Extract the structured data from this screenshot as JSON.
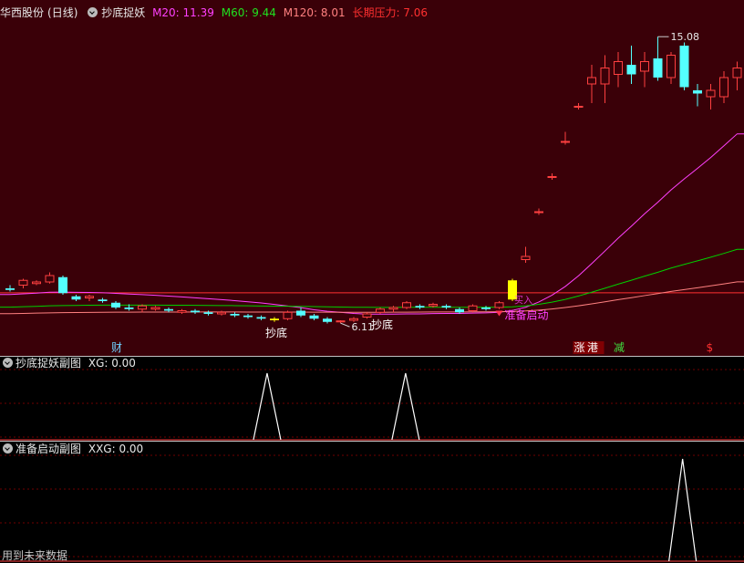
{
  "header": {
    "stock": "华西股份",
    "period": "(日线)",
    "indicator": "抄底捉妖",
    "ma20": "M20: 11.39",
    "ma60": "M60: 9.44",
    "ma120": "M120: 8.01",
    "pressure": "长期压力: 7.06"
  },
  "main_chart": {
    "high_label": "15.08",
    "low_label": "6.11",
    "signal_labels": [
      "抄底",
      "抄底"
    ],
    "start_label": "准备启动",
    "buy_label": "买入",
    "event_marks": [
      "财",
      "涨",
      "港",
      "减",
      "$"
    ]
  },
  "panel1": {
    "title": "抄底捉妖副图",
    "value_label": "XG: 0.00"
  },
  "panel2": {
    "title": "准备启动副图",
    "value_label": "XXG: 0.00"
  },
  "footer": {
    "text": "用到未来数据"
  },
  "colors": {
    "up": "#ff4040",
    "down": "#54ffff",
    "ma20": "#ff40ff",
    "ma60": "#00d000",
    "ma120": "#ff8080",
    "pressure": "#ff3030",
    "signal": "#ffff00"
  },
  "chart_data": {
    "type": "candlestick",
    "ohlc_note": "approximate daily candles, price units",
    "candles": [
      [
        7.2,
        7.3,
        7.1,
        7.15
      ],
      [
        7.3,
        7.5,
        7.2,
        7.45
      ],
      [
        7.35,
        7.45,
        7.3,
        7.4
      ],
      [
        7.4,
        7.7,
        7.35,
        7.6
      ],
      [
        7.55,
        7.6,
        7.0,
        7.05
      ],
      [
        6.95,
        7.0,
        6.8,
        6.85
      ],
      [
        6.9,
        7.0,
        6.8,
        6.95
      ],
      [
        6.85,
        6.9,
        6.75,
        6.8
      ],
      [
        6.75,
        6.8,
        6.55,
        6.6
      ],
      [
        6.6,
        6.7,
        6.5,
        6.55
      ],
      [
        6.55,
        6.7,
        6.45,
        6.65
      ],
      [
        6.55,
        6.65,
        6.5,
        6.6
      ],
      [
        6.55,
        6.6,
        6.45,
        6.5
      ],
      [
        6.45,
        6.55,
        6.4,
        6.5
      ],
      [
        6.5,
        6.55,
        6.4,
        6.45
      ],
      [
        6.45,
        6.5,
        6.35,
        6.4
      ],
      [
        6.4,
        6.5,
        6.35,
        6.45
      ],
      [
        6.4,
        6.45,
        6.3,
        6.35
      ],
      [
        6.35,
        6.4,
        6.25,
        6.3
      ],
      [
        6.3,
        6.35,
        6.2,
        6.25
      ],
      [
        6.2,
        6.3,
        6.15,
        6.25
      ],
      [
        6.25,
        6.5,
        6.2,
        6.45
      ],
      [
        6.5,
        6.6,
        6.3,
        6.35
      ],
      [
        6.35,
        6.4,
        6.2,
        6.25
      ],
      [
        6.25,
        6.3,
        6.1,
        6.15
      ],
      [
        6.15,
        6.2,
        6.11,
        6.18
      ],
      [
        6.2,
        6.3,
        6.15,
        6.25
      ],
      [
        6.3,
        6.45,
        6.25,
        6.4
      ],
      [
        6.45,
        6.6,
        6.4,
        6.55
      ],
      [
        6.55,
        6.65,
        6.45,
        6.6
      ],
      [
        6.6,
        6.8,
        6.55,
        6.75
      ],
      [
        6.65,
        6.7,
        6.55,
        6.6
      ],
      [
        6.65,
        6.75,
        6.6,
        6.7
      ],
      [
        6.65,
        6.7,
        6.55,
        6.6
      ],
      [
        6.55,
        6.6,
        6.4,
        6.45
      ],
      [
        6.5,
        6.7,
        6.45,
        6.65
      ],
      [
        6.6,
        6.65,
        6.5,
        6.55
      ],
      [
        6.6,
        6.8,
        6.55,
        6.75
      ],
      [
        6.85,
        7.5,
        6.8,
        7.45
      ],
      [
        8.1,
        8.5,
        8.0,
        8.2
      ],
      [
        9.6,
        9.7,
        9.5,
        9.6
      ],
      [
        10.7,
        10.8,
        10.6,
        10.7
      ],
      [
        11.8,
        12.1,
        11.7,
        11.8
      ],
      [
        12.9,
        13.0,
        12.8,
        12.9
      ],
      [
        13.6,
        14.2,
        13.0,
        13.8
      ],
      [
        13.6,
        14.5,
        13.0,
        14.1
      ],
      [
        13.9,
        14.6,
        13.5,
        14.3
      ],
      [
        14.2,
        14.8,
        13.6,
        13.9
      ],
      [
        14.0,
        14.6,
        13.5,
        14.3
      ],
      [
        14.4,
        15.08,
        13.7,
        13.8
      ],
      [
        13.8,
        14.6,
        13.6,
        14.5
      ],
      [
        14.8,
        14.9,
        13.4,
        13.5
      ],
      [
        13.4,
        13.6,
        12.9,
        13.3
      ],
      [
        13.2,
        13.6,
        12.8,
        13.4
      ],
      [
        13.2,
        14.0,
        13.0,
        13.8
      ],
      [
        13.8,
        14.3,
        13.4,
        14.1
      ]
    ],
    "panel1_peaks": [
      0.27,
      0.41
    ],
    "panel2_peaks": [
      0.69
    ]
  }
}
